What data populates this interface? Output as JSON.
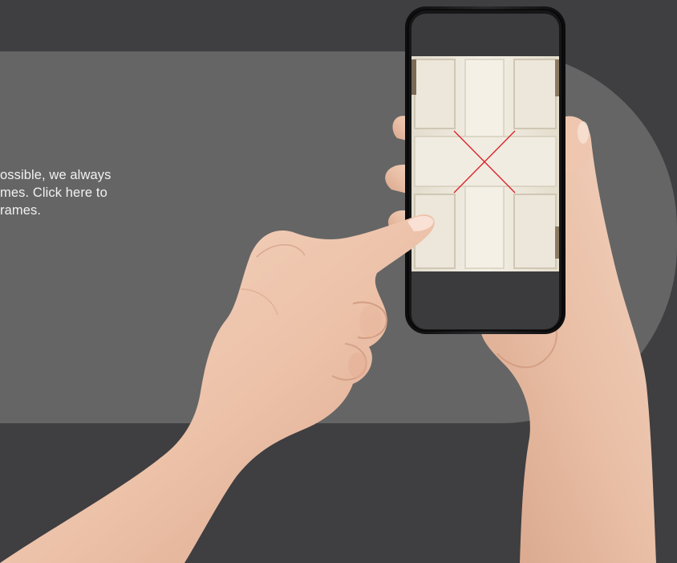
{
  "copy": {
    "line1": "ossible, we always",
    "line2_prefix": "mes. ",
    "line2_link": "Click here to",
    "line3": "rames."
  },
  "illustration": {
    "subject": "hands-holding-smartphone-photo",
    "phone_screen_content": "door-panel-photo-with-red-x"
  },
  "colors": {
    "page_bg": "#3f3e41",
    "panel_bg": "#656565",
    "text": "#f1f1f1",
    "phone_body": "#1a1a1b",
    "phone_screen_dark": "#3c3c3e",
    "door_cream": "#efe9dc",
    "cross_mark": "#d9262a",
    "skin": "#efc8b0"
  }
}
